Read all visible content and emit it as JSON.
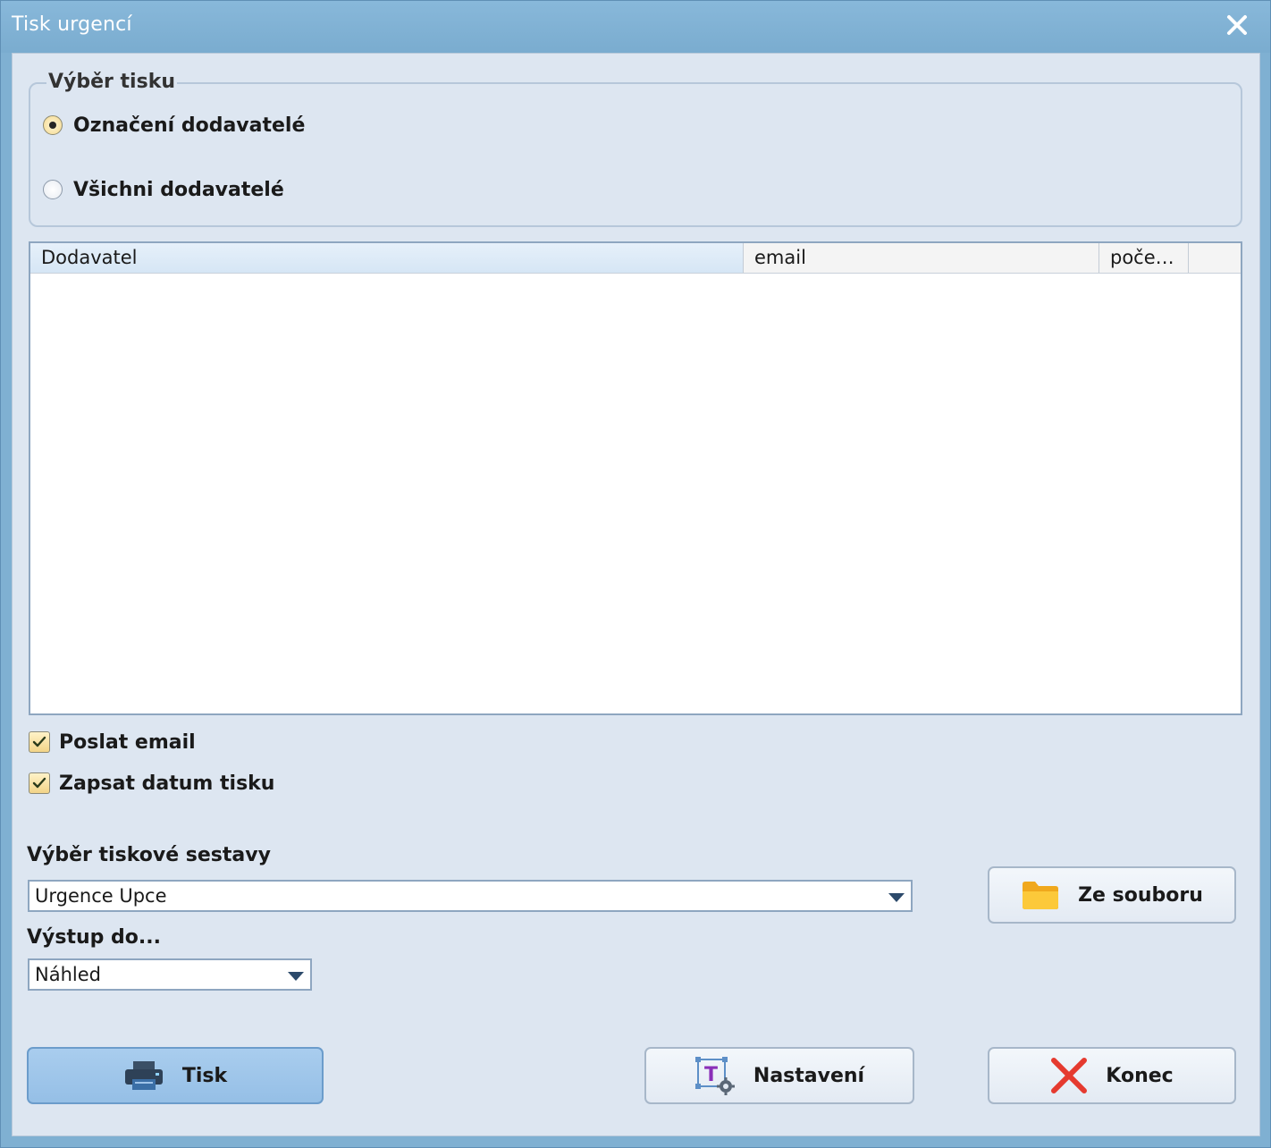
{
  "window": {
    "title": "Tisk urgencí"
  },
  "print_selection": {
    "legend": "Výběr tisku",
    "options": [
      {
        "label": "Označení dodavatelé",
        "checked": true
      },
      {
        "label": "Všichni  dodavatelé",
        "checked": false
      }
    ]
  },
  "grid": {
    "columns": [
      "Dodavatel",
      "email",
      "poče…",
      ""
    ],
    "rows": []
  },
  "checkboxes": {
    "send_email": {
      "label": "Poslat email",
      "checked": true
    },
    "write_print_date": {
      "label": "Zapsat datum tisku",
      "checked": true
    }
  },
  "report": {
    "label": "Výběr tiskové sestavy",
    "selected": "Urgence Upce"
  },
  "output": {
    "label": "Výstup do...",
    "selected": "Náhled"
  },
  "buttons": {
    "from_file": "Ze souboru",
    "print": "Tisk",
    "settings": "Nastavení",
    "close": "Konec"
  },
  "icons": {
    "window_close": "close-icon",
    "from_file": "folder-icon",
    "print": "printer-icon",
    "settings": "text-settings-icon",
    "close": "red-x-icon"
  }
}
